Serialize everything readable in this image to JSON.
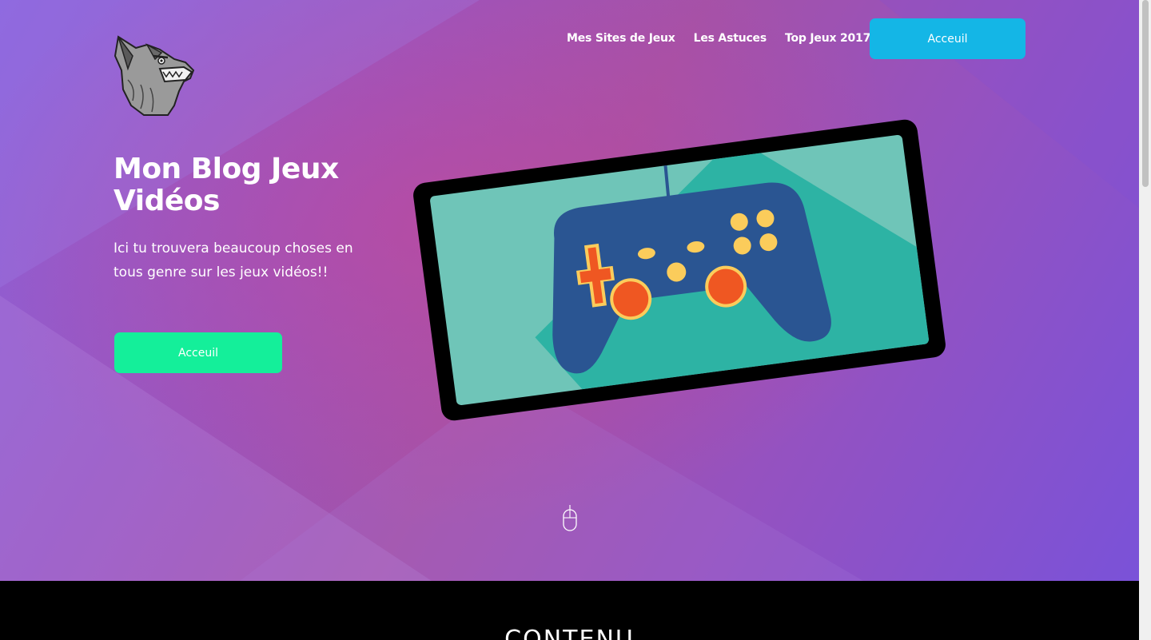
{
  "nav": {
    "items": [
      {
        "label": "Mes Sites de Jeux"
      },
      {
        "label": "Les Astuces"
      },
      {
        "label": "Top Jeux 2017"
      }
    ],
    "button_label": "Acceuil"
  },
  "hero": {
    "title": "Mon Blog Jeux Vidéos",
    "subtitle": "Ici tu trouvera beaucoup choses en tous genre sur les jeux vidéos!!",
    "cta_label": "Acceuil"
  },
  "section": {
    "title": "CONTENU"
  },
  "colors": {
    "nav_button": "#14b6e6",
    "cta_button": "#14ef9a",
    "screen": "#6fc5b8",
    "controller": "#2a5592",
    "accent_orange": "#ef5722",
    "accent_yellow": "#fbcc5b"
  },
  "icons": [
    "wolf-logo-icon",
    "gamepad-tablet-illustration",
    "scroll-mouse-icon"
  ]
}
